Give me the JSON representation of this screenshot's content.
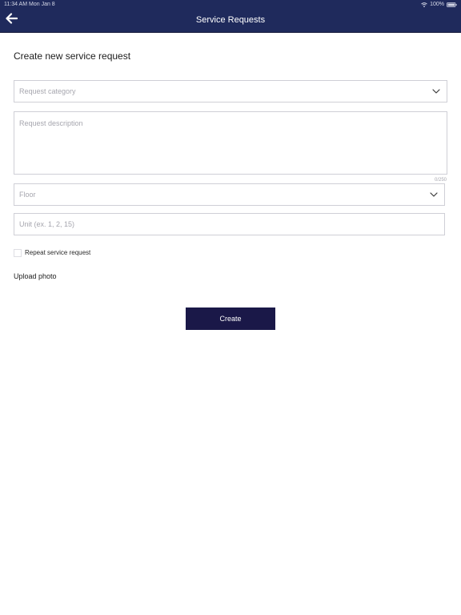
{
  "status_bar": {
    "time_date": "11:34 AM  Mon Jan 8",
    "battery": "100%"
  },
  "header": {
    "title": "Service Requests"
  },
  "form": {
    "heading": "Create new service request",
    "category_placeholder": "Request category",
    "description_placeholder": "Request description",
    "description_counter": "0/250",
    "floor_placeholder": "Floor",
    "unit_placeholder": "Unit (ex. 1, 2, 15)",
    "repeat_label": "Repeat service request",
    "repeat_checked": false,
    "upload_label": "Upload photo",
    "create_label": "Create"
  },
  "colors": {
    "header_background": "#1f2a5c",
    "button_background": "#1a1848",
    "field_border": "#cfcfd6",
    "placeholder_text": "#a6a6ae"
  },
  "icons": {
    "back": "arrow-left-icon",
    "dropdown": "chevron-down-icon",
    "wifi": "wifi-icon",
    "battery": "battery-icon"
  }
}
